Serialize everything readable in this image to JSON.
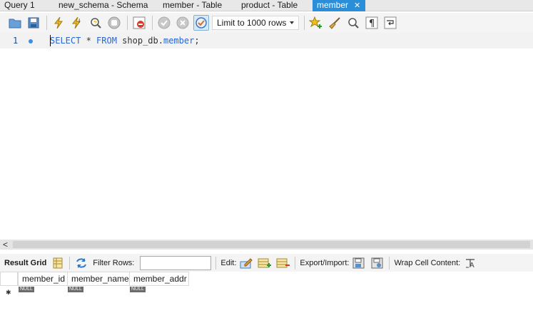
{
  "tabs": [
    {
      "label": "Query 1",
      "active": false
    },
    {
      "label": "new_schema - Schema",
      "active": false
    },
    {
      "label": "member - Table",
      "active": false
    },
    {
      "label": "product - Table",
      "active": false
    },
    {
      "label": "member",
      "active": true,
      "close": "✕"
    }
  ],
  "toolbar": {
    "limit_label": "Limit to 1000 rows"
  },
  "editor": {
    "line_number": "1",
    "tokens": {
      "select": "SELECT",
      "star": " * ",
      "from": "FROM",
      "schema": " shop_db.",
      "table": "member",
      "semicolon": ";"
    }
  },
  "scroll": {
    "left_arrow": "<"
  },
  "result_toolbar": {
    "result_grid": "Result Grid",
    "filter_rows": "Filter Rows:",
    "edit": "Edit:",
    "export_import": "Export/Import:",
    "wrap_cell": "Wrap Cell Content:"
  },
  "grid": {
    "columns": [
      "member_id",
      "member_name",
      "member_addr"
    ],
    "new_row_marker": "✱",
    "null_label": "NULL"
  },
  "colors": {
    "active_tab": "#2a8fd8",
    "keyword": "#2867d6",
    "line_bg": "#f2f2f2"
  }
}
